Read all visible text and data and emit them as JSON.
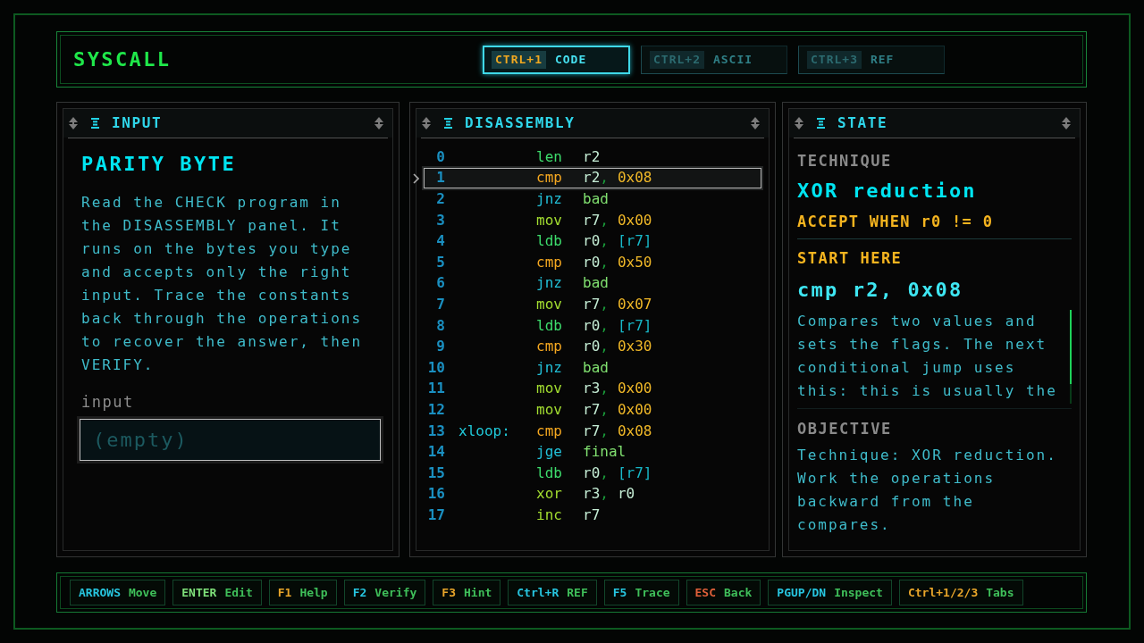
{
  "app": {
    "title": "SYSCALL"
  },
  "tabs": [
    {
      "key": "CTRL+1",
      "label": "CODE",
      "selected": true
    },
    {
      "key": "CTRL+2",
      "label": "ASCII",
      "selected": false
    },
    {
      "key": "CTRL+3",
      "label": "REF",
      "selected": false
    }
  ],
  "panels": {
    "input": {
      "title": "INPUT",
      "heading": "PARITY BYTE",
      "description": "Read the CHECK program in the DISASSEMBLY panel. It runs on the bytes you type and accepts only the right input. Trace the constants back through the operations to recover the answer, then VERIFY.",
      "field_label": "input",
      "field": {
        "placeholder": "(empty)"
      }
    },
    "disassembly": {
      "title": "DISASSEMBLY",
      "lines": [
        {
          "number": "0",
          "mnemonic": "len",
          "kind": "load",
          "selected": false,
          "operands": [
            {
              "text": "r2",
              "kind": "register"
            }
          ]
        },
        {
          "number": "1",
          "mnemonic": "cmp",
          "kind": "compare",
          "selected": true,
          "operands": [
            {
              "text": "r2",
              "kind": "register"
            },
            {
              "text": ",",
              "kind": "separator"
            },
            {
              "text": "0x08",
              "kind": "immediate"
            }
          ]
        },
        {
          "number": "2",
          "mnemonic": "jnz",
          "kind": "branch",
          "selected": false,
          "operands": [
            {
              "text": "bad",
              "kind": "target"
            }
          ]
        },
        {
          "number": "3",
          "mnemonic": "mov",
          "kind": "alu",
          "selected": false,
          "operands": [
            {
              "text": "r7",
              "kind": "register"
            },
            {
              "text": ",",
              "kind": "separator"
            },
            {
              "text": "0x00",
              "kind": "immediate"
            }
          ]
        },
        {
          "number": "4",
          "mnemonic": "ldb",
          "kind": "load",
          "selected": false,
          "operands": [
            {
              "text": "r0",
              "kind": "register"
            },
            {
              "text": ",",
              "kind": "separator"
            },
            {
              "text": "[r7]",
              "kind": "memory"
            }
          ]
        },
        {
          "number": "5",
          "mnemonic": "cmp",
          "kind": "compare",
          "selected": false,
          "operands": [
            {
              "text": "r0",
              "kind": "register"
            },
            {
              "text": ",",
              "kind": "separator"
            },
            {
              "text": "0x50",
              "kind": "immediate"
            }
          ]
        },
        {
          "number": "6",
          "mnemonic": "jnz",
          "kind": "branch",
          "selected": false,
          "operands": [
            {
              "text": "bad",
              "kind": "target"
            }
          ]
        },
        {
          "number": "7",
          "mnemonic": "mov",
          "kind": "alu",
          "selected": false,
          "operands": [
            {
              "text": "r7",
              "kind": "register"
            },
            {
              "text": ",",
              "kind": "separator"
            },
            {
              "text": "0x07",
              "kind": "immediate"
            }
          ]
        },
        {
          "number": "8",
          "mnemonic": "ldb",
          "kind": "load",
          "selected": false,
          "operands": [
            {
              "text": "r0",
              "kind": "register"
            },
            {
              "text": ",",
              "kind": "separator"
            },
            {
              "text": "[r7]",
              "kind": "memory"
            }
          ]
        },
        {
          "number": "9",
          "mnemonic": "cmp",
          "kind": "compare",
          "selected": false,
          "operands": [
            {
              "text": "r0",
              "kind": "register"
            },
            {
              "text": ",",
              "kind": "separator"
            },
            {
              "text": "0x30",
              "kind": "immediate"
            }
          ]
        },
        {
          "number": "10",
          "mnemonic": "jnz",
          "kind": "branch",
          "selected": false,
          "operands": [
            {
              "text": "bad",
              "kind": "target"
            }
          ]
        },
        {
          "number": "11",
          "mnemonic": "mov",
          "kind": "alu",
          "selected": false,
          "operands": [
            {
              "text": "r3",
              "kind": "register"
            },
            {
              "text": ",",
              "kind": "separator"
            },
            {
              "text": "0x00",
              "kind": "immediate"
            }
          ]
        },
        {
          "number": "12",
          "mnemonic": "mov",
          "kind": "alu",
          "selected": false,
          "operands": [
            {
              "text": "r7",
              "kind": "register"
            },
            {
              "text": ",",
              "kind": "separator"
            },
            {
              "text": "0x00",
              "kind": "immediate"
            }
          ]
        },
        {
          "number": "13",
          "label": "xloop:",
          "mnemonic": "cmp",
          "kind": "compare",
          "selected": false,
          "operands": [
            {
              "text": "r7",
              "kind": "register"
            },
            {
              "text": ",",
              "kind": "separator"
            },
            {
              "text": "0x08",
              "kind": "immediate"
            }
          ]
        },
        {
          "number": "14",
          "mnemonic": "jge",
          "kind": "branch",
          "selected": false,
          "operands": [
            {
              "text": "final",
              "kind": "target"
            }
          ]
        },
        {
          "number": "15",
          "mnemonic": "ldb",
          "kind": "load",
          "selected": false,
          "operands": [
            {
              "text": "r0",
              "kind": "register"
            },
            {
              "text": ",",
              "kind": "separator"
            },
            {
              "text": "[r7]",
              "kind": "memory"
            }
          ]
        },
        {
          "number": "16",
          "mnemonic": "xor",
          "kind": "alu",
          "selected": false,
          "operands": [
            {
              "text": "r3",
              "kind": "register"
            },
            {
              "text": ",",
              "kind": "separator"
            },
            {
              "text": "r0",
              "kind": "register"
            }
          ]
        },
        {
          "number": "17",
          "mnemonic": "inc",
          "kind": "alu",
          "selected": false,
          "operands": [
            {
              "text": "r7",
              "kind": "register"
            }
          ]
        }
      ]
    },
    "state": {
      "title": "STATE",
      "technique_label": "TECHNIQUE",
      "technique": "XOR reduction",
      "accept_condition": "ACCEPT WHEN r0 != 0",
      "start_label": "START HERE",
      "start_instruction": "cmp r2, 0x08",
      "start_note": "Compares two values and sets the flags. The next conditional jump uses this: this is usually the",
      "objective_label": "OBJECTIVE",
      "objective": "Technique: XOR reduction. Work the operations backward from the compares."
    }
  },
  "key_hints": [
    {
      "key": "ARROWS",
      "action": "Move",
      "color": "#27c6e0"
    },
    {
      "key": "ENTER",
      "action": "Edit",
      "color": "#7fe07a"
    },
    {
      "key": "F1",
      "action": "Help",
      "color": "#e8a52a"
    },
    {
      "key": "F2",
      "action": "Verify",
      "color": "#27c6e0"
    },
    {
      "key": "F3",
      "action": "Hint",
      "color": "#e8a52a"
    },
    {
      "key": "Ctrl+R",
      "action": "REF",
      "color": "#27c6e0"
    },
    {
      "key": "F5",
      "action": "Trace",
      "color": "#27c6e0"
    },
    {
      "key": "ESC",
      "action": "Back",
      "color": "#e0603a"
    },
    {
      "key": "PGUP/DN",
      "action": "Inspect",
      "color": "#27c6e0"
    },
    {
      "key": "Ctrl+1/2/3",
      "action": "Tabs",
      "color": "#e8a52a"
    }
  ]
}
